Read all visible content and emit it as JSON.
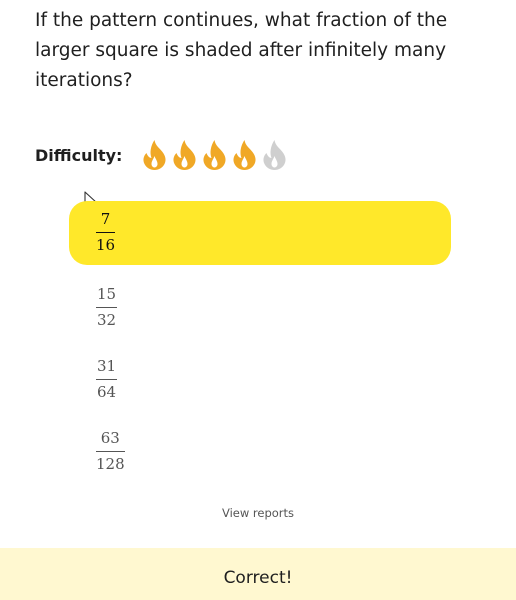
{
  "question": {
    "text": "If the pattern continues, what fraction of the larger square is shaded after infinitely many iterations?"
  },
  "difficulty": {
    "label": "Difficulty:",
    "level": 4,
    "max": 5,
    "active_color": "#f0a826",
    "inactive_color": "#cfcfcf",
    "icon": "flame-icon"
  },
  "options": [
    {
      "numerator": "7",
      "denominator": "16",
      "selected": true
    },
    {
      "numerator": "15",
      "denominator": "32",
      "selected": false
    },
    {
      "numerator": "31",
      "denominator": "64",
      "selected": false
    },
    {
      "numerator": "63",
      "denominator": "128",
      "selected": false
    }
  ],
  "links": {
    "view_reports": "View reports"
  },
  "result": {
    "text": "Correct!",
    "background": "#fff8d0"
  },
  "colors": {
    "selected_option": "#ffe82a"
  }
}
